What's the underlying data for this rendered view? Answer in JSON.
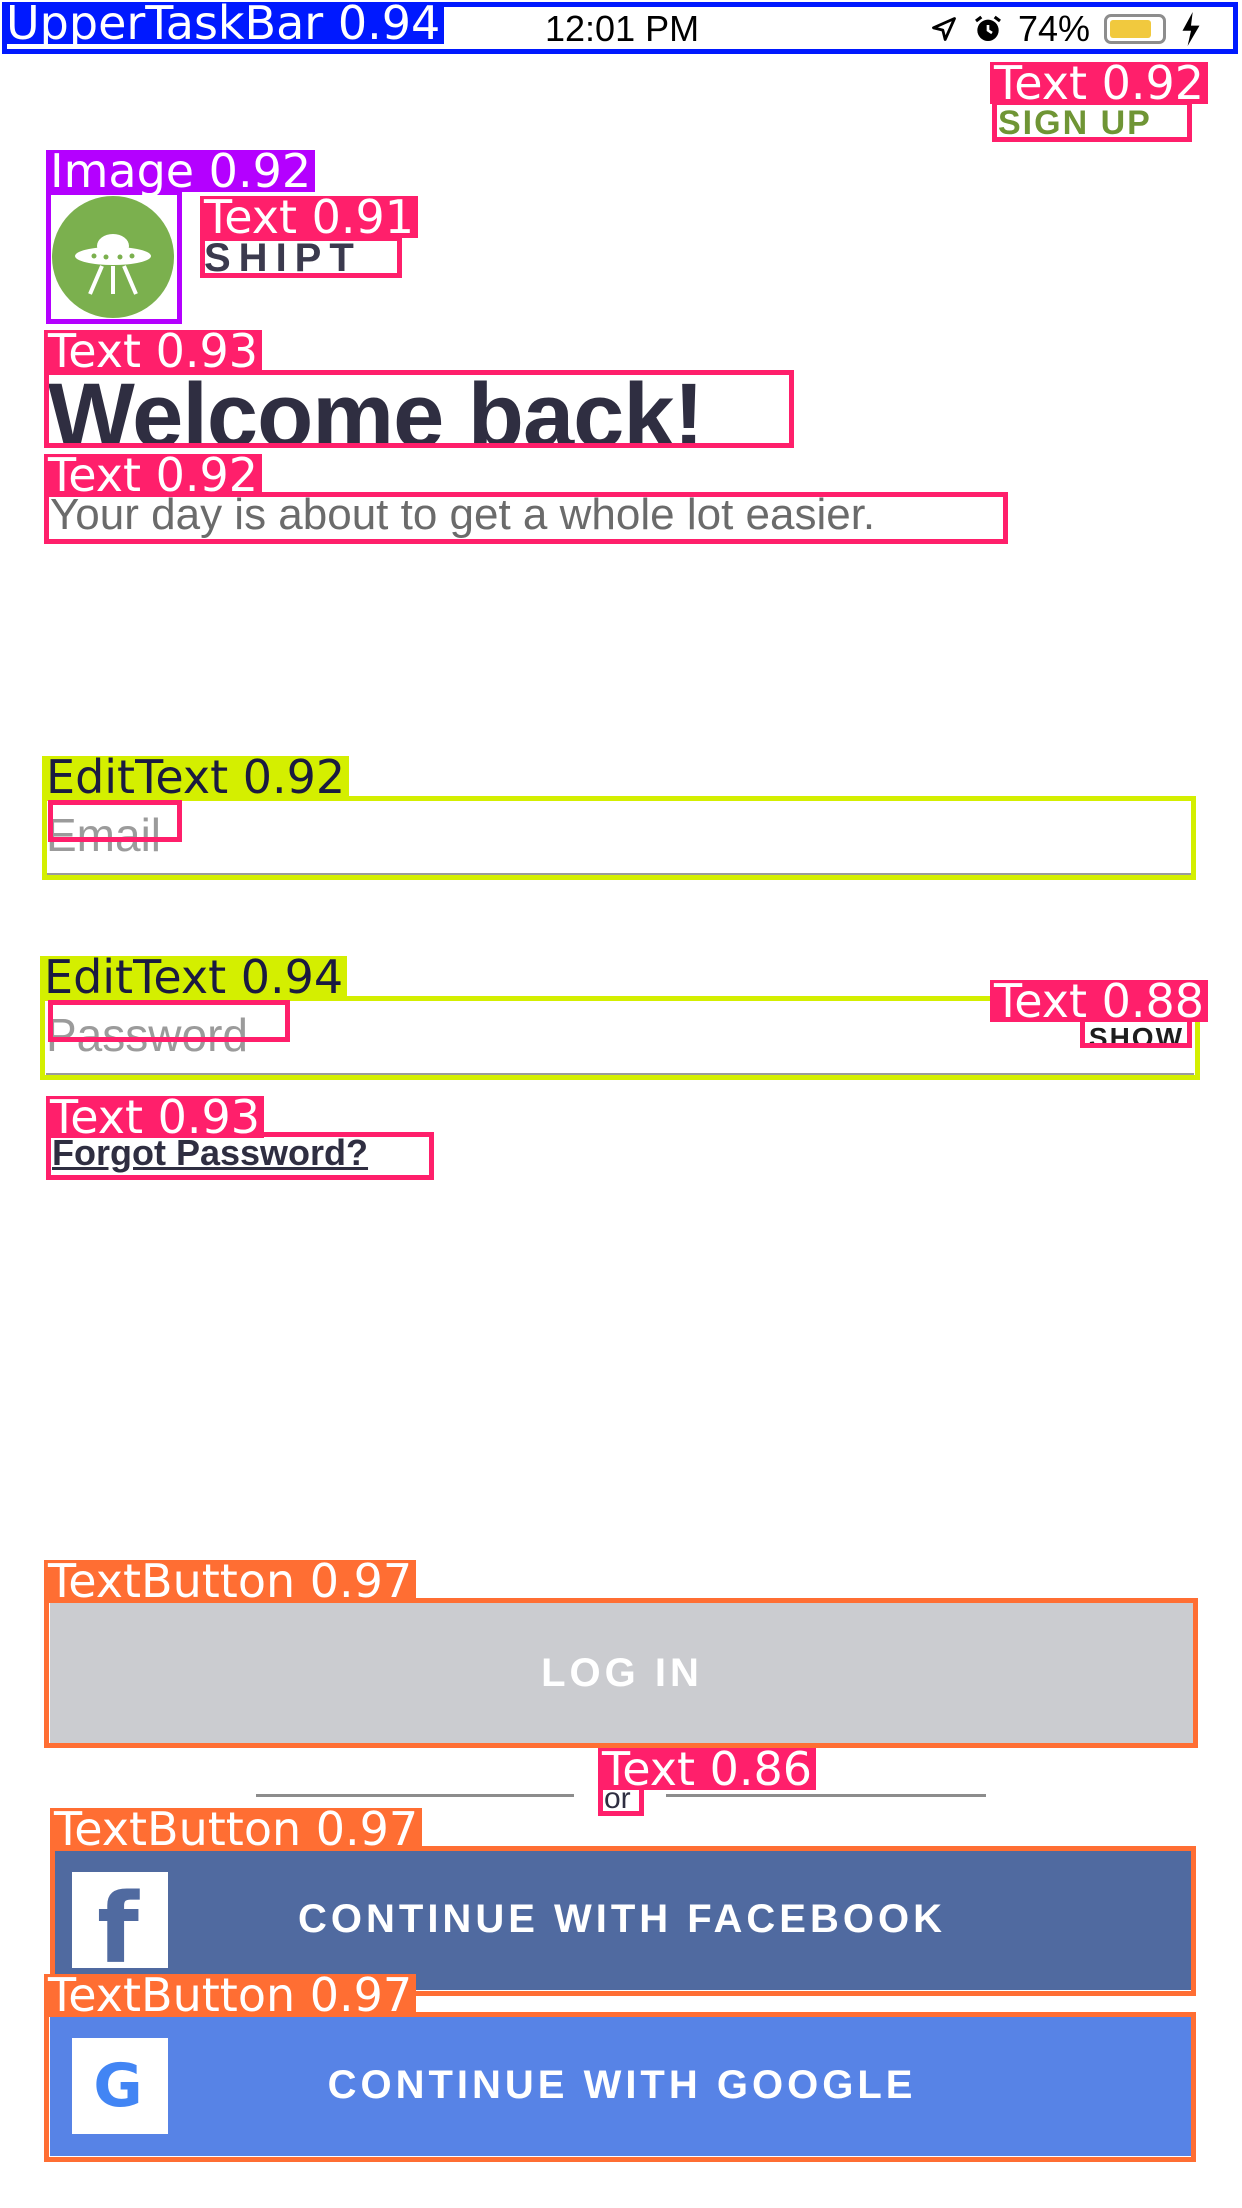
{
  "status_bar": {
    "time": "12:01 PM",
    "battery_percent": "74%",
    "battery_level": 0.74
  },
  "header": {
    "signup_label": "SIGN UP"
  },
  "brand": {
    "name": "SHIPT",
    "logo_color": "#7bb04e"
  },
  "welcome": {
    "title": "Welcome back!",
    "subtitle": "Your day is about to get a whole lot easier."
  },
  "form": {
    "email_placeholder": "Email",
    "password_placeholder": "Password",
    "show_label": "SHOW",
    "forgot_label": "Forgot Password?"
  },
  "actions": {
    "login_label": "LOG IN",
    "or_label": "or",
    "facebook_label": "CONTINUE WITH FACEBOOK",
    "google_label": "CONTINUE WITH GOOGLE"
  },
  "annotations": {
    "upper_task_bar": "UpperTaskBar 0.94",
    "signup_text": "Text 0.92",
    "logo_image": "Image 0.92",
    "brand_text": "Text 0.91",
    "welcome_text": "Text 0.93",
    "subtitle_text": "Text 0.92",
    "email_edit": "EditText 0.92",
    "password_edit": "EditText 0.94",
    "show_text": "Text 0.88",
    "forgot_text": "Text 0.93",
    "login_button": "TextButton 0.97",
    "or_text": "Text 0.86",
    "facebook_button": "TextButton 0.97",
    "google_button": "TextButton 0.97"
  },
  "colors": {
    "text_box": "#ff1f6b",
    "edit_box": "#d4ef00",
    "button_box": "#ff6e33",
    "image_box": "#b400ff",
    "taskbar_box": "#0019ff",
    "facebook": "#506aa0",
    "google": "#5783e6",
    "login_disabled": "#cbccd0"
  }
}
